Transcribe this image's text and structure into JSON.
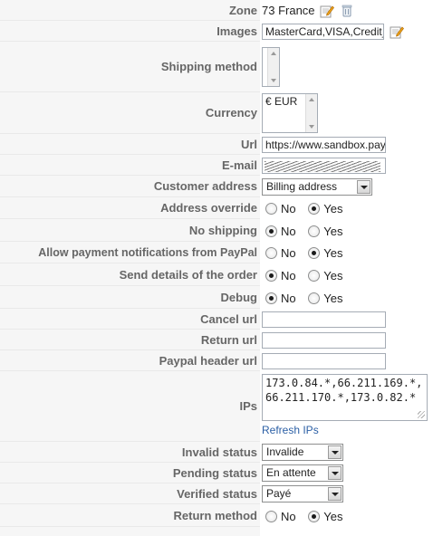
{
  "rows": {
    "zone": {
      "label": "Zone",
      "value": "73 France"
    },
    "images": {
      "label": "Images",
      "value": "MasterCard,VISA,Credit_"
    },
    "shipping_method": {
      "label": "Shipping method"
    },
    "currency": {
      "label": "Currency",
      "value": "€ EUR"
    },
    "url": {
      "label": "Url",
      "value": "https://www.sandbox.pay"
    },
    "email": {
      "label": "E-mail"
    },
    "customer_address": {
      "label": "Customer address",
      "value": "Billing address"
    },
    "address_override": {
      "label": "Address override",
      "selected": "Yes"
    },
    "no_shipping": {
      "label": "No shipping",
      "selected": "No"
    },
    "allow_notifications": {
      "label": "Allow payment notifications from PayPal",
      "selected": "Yes"
    },
    "send_details": {
      "label": "Send details of the order",
      "selected": "No"
    },
    "debug": {
      "label": "Debug",
      "selected": "No"
    },
    "cancel_url": {
      "label": "Cancel url",
      "value": ""
    },
    "return_url": {
      "label": "Return url",
      "value": ""
    },
    "paypal_header_url": {
      "label": "Paypal header url",
      "value": ""
    },
    "ips": {
      "label": "IPs",
      "value": "173.0.84.*,66.211.169.*,66.211.170.*,173.0.82.*",
      "refresh_label": "Refresh IPs"
    },
    "invalid_status": {
      "label": "Invalid status",
      "value": "Invalide"
    },
    "pending_status": {
      "label": "Pending status",
      "value": "En attente"
    },
    "verified_status": {
      "label": "Verified status",
      "value": "Payé"
    },
    "return_method": {
      "label": "Return method",
      "selected": "Yes"
    }
  },
  "radio_labels": {
    "no": "No",
    "yes": "Yes"
  },
  "icons": {
    "edit": "edit-pencil-icon",
    "delete": "trash-icon"
  }
}
